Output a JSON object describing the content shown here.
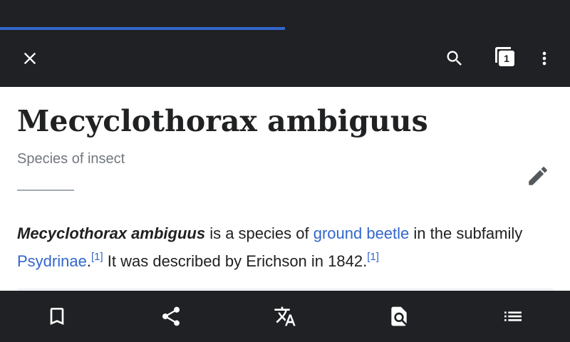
{
  "loading": {
    "progress_percent": 50
  },
  "toolbar": {
    "close_icon": "close-icon",
    "search_icon": "search-icon",
    "tabs_icon": "tabs-icon",
    "tab_count": "1",
    "menu_icon": "more-vert-icon"
  },
  "article": {
    "title": "Mecyclothorax ambiguus",
    "description": "Species of insect",
    "edit_icon": "pencil-icon",
    "lead": {
      "term": "Mecyclothorax ambiguus",
      "text1": " is a species of ",
      "link1": "ground beetle",
      "text2": " in the subfamily ",
      "link2": "Psydrinae",
      "text3": ".",
      "ref1": "[1]",
      "text4": " It was described by Erichson in 1842.",
      "ref2": "[1]"
    }
  },
  "bottom_bar": {
    "icons": [
      "bookmark-icon",
      "share-icon",
      "translate-icon",
      "find-in-page-icon",
      "contents-icon"
    ]
  },
  "colors": {
    "bar": "#202124",
    "link": "#3366cc",
    "progress": "#3366cc"
  }
}
